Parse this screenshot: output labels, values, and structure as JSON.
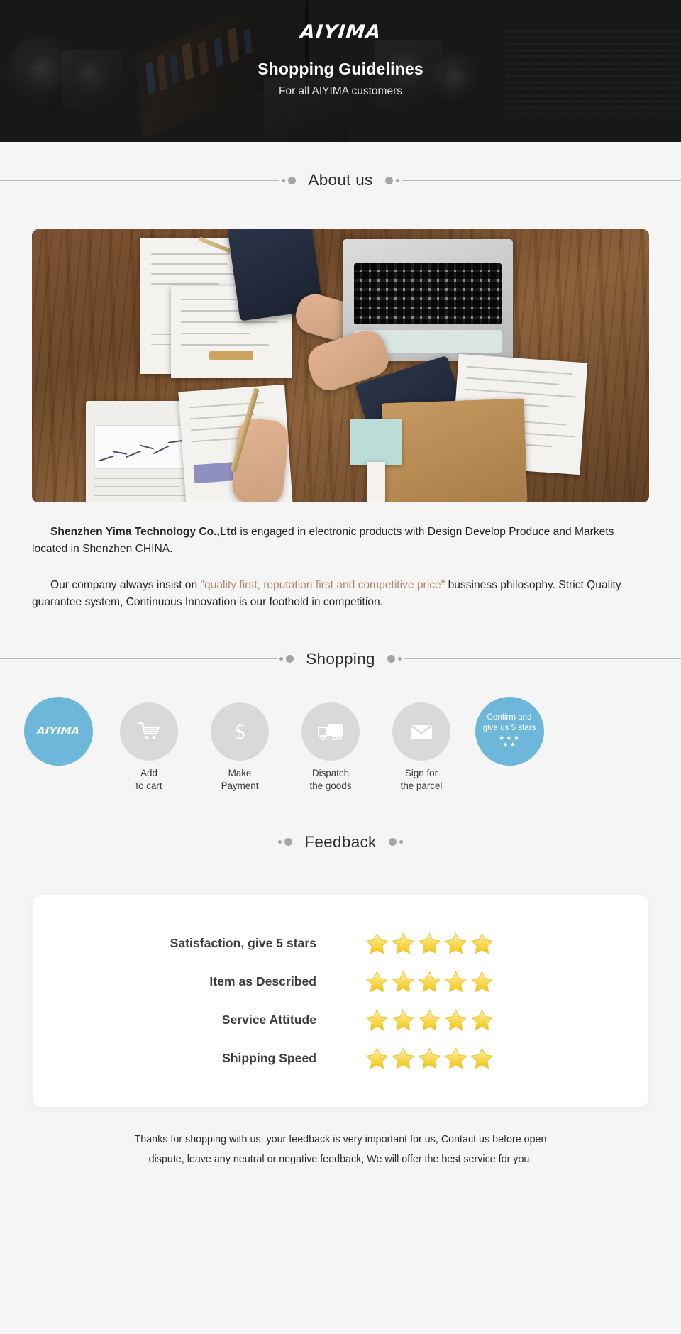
{
  "banner": {
    "logo": "AIYIMA",
    "title": "Shopping Guidelines",
    "subtitle": "For all AIYIMA customers"
  },
  "sections": {
    "about_title": "About us",
    "shopping_title": "Shopping",
    "feedback_title": "Feedback"
  },
  "about": {
    "p1_bold": "Shenzhen Yima Technology Co.,Ltd",
    "p1_rest": " is engaged in electronic products with Design Develop Produce and Markets located in Shenzhen CHINA.",
    "p2_before": "Our company always insist on ",
    "p2_highlight": "\"quality first, reputation first and competitive price\"",
    "p2_after": " bussiness philosophy. Strict Quality guarantee system, Continuous Innovation is our foothold in competition."
  },
  "steps": [
    {
      "type": "logo",
      "icon": "aiyima-logo",
      "logo": "AIYIMA",
      "label": ""
    },
    {
      "type": "icon",
      "icon": "cart-icon",
      "label": "Add\nto cart"
    },
    {
      "type": "icon",
      "icon": "dollar-icon",
      "label": "Make\nPayment"
    },
    {
      "type": "icon",
      "icon": "truck-icon",
      "label": "Dispatch\nthe goods"
    },
    {
      "type": "icon",
      "icon": "envelope-icon",
      "label": "Sign for\nthe parcel"
    },
    {
      "type": "final",
      "icon": "stars-icon",
      "label": "",
      "text": "Confirm and\ngive us 5 stars",
      "stars_top": "★★★",
      "stars_bottom": "★★"
    }
  ],
  "feedback": {
    "rows": [
      {
        "label": "Satisfaction, give 5 stars",
        "stars": 5
      },
      {
        "label": "Item as Described",
        "stars": 5
      },
      {
        "label": "Service Attitude",
        "stars": 5
      },
      {
        "label": "Shipping Speed",
        "stars": 5
      }
    ]
  },
  "footer": {
    "line1": "Thanks for shopping with us, your feedback is very important for us, Contact us before open",
    "line2": "dispute, leave any neutral or negative feedback, We will offer the best service for you."
  },
  "colors": {
    "banner_bg": "#181818",
    "page_bg": "#f5f5f5",
    "accent_blue": "#6cb7da",
    "step_grey": "#d9d9d9",
    "quote_tan": "#b08968",
    "star_yellow": "#f7d74a"
  }
}
